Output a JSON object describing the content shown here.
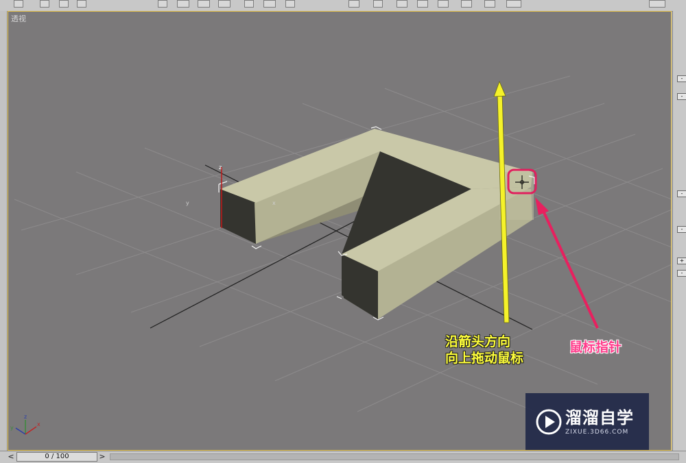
{
  "viewport": {
    "label": "透视"
  },
  "annotations": {
    "drag_line1": "沿箭头方向",
    "drag_line2": "向上拖动鼠标",
    "pointer": "鼠标指针"
  },
  "gizmo": {
    "x": "x",
    "y": "y",
    "z": "z"
  },
  "watermark": {
    "title": "溜溜自学",
    "url": "ZIXUE.3D66.COM"
  },
  "timeline": {
    "frame": "0 / 100",
    "prev": "<",
    "next": ">"
  },
  "right_panel": {
    "collapse": "-",
    "expand": "+"
  },
  "colors": {
    "viewport_bg": "#7b797a",
    "object_top": "#c9c8a8",
    "object_side": "#8f8d75",
    "object_inner": "#34342f",
    "active_border": "#e7c34a",
    "arrow_yellow": "#f5f22a",
    "arrow_pink": "#e8205f"
  },
  "icons": [
    "select-icon",
    "move-icon",
    "rotate-icon",
    "scale-icon",
    "snap-icon",
    "mirror-icon",
    "align-icon",
    "render-icon",
    "cursor-crosshair-icon",
    "play-icon"
  ]
}
